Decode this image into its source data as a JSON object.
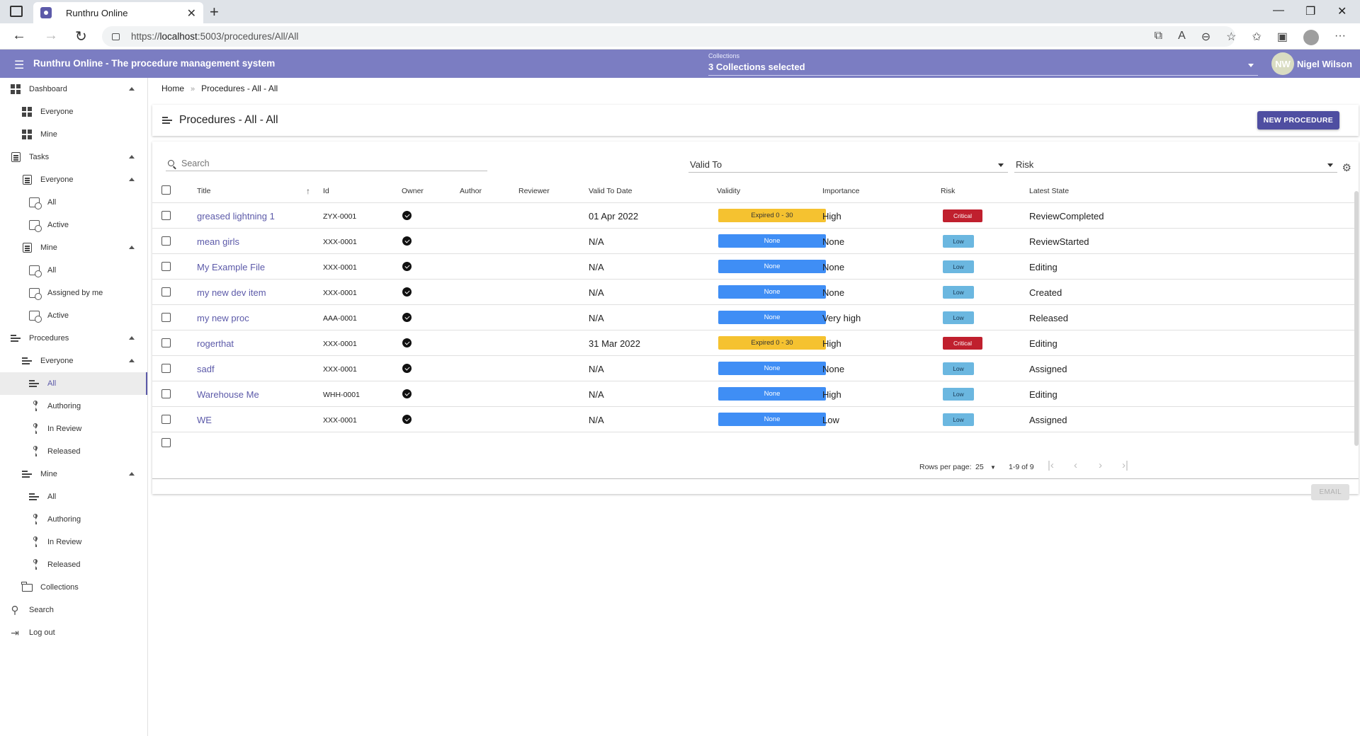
{
  "browser": {
    "tab_title": "Runthru Online",
    "url_prefix": "https://",
    "url_host": "localhost",
    "url_rest": ":5003/procedures/All/All"
  },
  "header": {
    "app_title": "Runthru Online - The procedure management system",
    "collections_label": "Collections",
    "collections_value": "3 Collections selected",
    "user_initials": "NW",
    "user_name": "Nigel Wilson",
    "color": "#7b7dc2"
  },
  "nav": {
    "dashboard": "Dashboard",
    "dashboard_everyone": "Everyone",
    "dashboard_mine": "Mine",
    "tasks": "Tasks",
    "tasks_everyone": "Everyone",
    "tasks_everyone_all": "All",
    "tasks_everyone_active": "Active",
    "tasks_mine": "Mine",
    "tasks_mine_all": "All",
    "tasks_mine_assigned": "Assigned by me",
    "tasks_mine_active": "Active",
    "procedures": "Procedures",
    "procedures_everyone": "Everyone",
    "proc_everyone_all": "All",
    "proc_everyone_authoring": "Authoring",
    "proc_everyone_inreview": "In Review",
    "proc_everyone_released": "Released",
    "procedures_mine": "Mine",
    "proc_mine_all": "All",
    "proc_mine_authoring": "Authoring",
    "proc_mine_inreview": "In Review",
    "proc_mine_released": "Released",
    "collections": "Collections",
    "search": "Search",
    "logout": "Log out"
  },
  "breadcrumb": {
    "home": "Home",
    "separator": "»",
    "current": "Procedures - All - All"
  },
  "page": {
    "title": "Procedures - All - All",
    "new_button": "NEW PROCEDURE",
    "email_button": "EMAIL"
  },
  "filters": {
    "search_placeholder": "Search",
    "valid_to": "Valid To",
    "risk": "Risk"
  },
  "table": {
    "columns": {
      "title": "Title",
      "id": "Id",
      "owner": "Owner",
      "author": "Author",
      "reviewer": "Reviewer",
      "valid_to_date": "Valid To Date",
      "validity": "Validity",
      "importance": "Importance",
      "risk": "Risk",
      "latest_state": "Latest State"
    },
    "rows": [
      {
        "title": "greased lightning 1",
        "id": "ZYX-0001",
        "valid_to": "01 Apr 2022",
        "validity": "Expired 0 - 30",
        "importance": "High",
        "risk": "Critical",
        "state": "ReviewCompleted"
      },
      {
        "title": "mean girls",
        "id": "XXX-0001",
        "valid_to": "N/A",
        "validity": "None",
        "importance": "None",
        "risk": "Low",
        "state": "ReviewStarted"
      },
      {
        "title": "My Example File",
        "id": "XXX-0001",
        "valid_to": "N/A",
        "validity": "None",
        "importance": "None",
        "risk": "Low",
        "state": "Editing"
      },
      {
        "title": "my new dev item",
        "id": "XXX-0001",
        "valid_to": "N/A",
        "validity": "None",
        "importance": "None",
        "risk": "Low",
        "state": "Created"
      },
      {
        "title": "my new proc",
        "id": "AAA-0001",
        "valid_to": "N/A",
        "validity": "None",
        "importance": "Very high",
        "risk": "Low",
        "state": "Released"
      },
      {
        "title": "rogerthat",
        "id": "XXX-0001",
        "valid_to": "31 Mar 2022",
        "validity": "Expired 0 - 30",
        "importance": "High",
        "risk": "Critical",
        "state": "Editing"
      },
      {
        "title": "sadf",
        "id": "XXX-0001",
        "valid_to": "N/A",
        "validity": "None",
        "importance": "None",
        "risk": "Low",
        "state": "Assigned"
      },
      {
        "title": "Warehouse Me",
        "id": "WHH-0001",
        "valid_to": "N/A",
        "validity": "None",
        "importance": "High",
        "risk": "Low",
        "state": "Editing"
      },
      {
        "title": "WE",
        "id": "XXX-0001",
        "valid_to": "N/A",
        "validity": "None",
        "importance": "Low",
        "risk": "Low",
        "state": "Assigned"
      }
    ]
  },
  "pagination": {
    "rows_per_page_label": "Rows per page:",
    "rows_per_page": "25",
    "range": "1-9 of 9"
  },
  "colors": {
    "expired": "#f5c230",
    "none_validity": "#3f8ef5",
    "critical": "#c0202e",
    "low": "#6bb7e0",
    "accent": "#5c5aa9"
  }
}
